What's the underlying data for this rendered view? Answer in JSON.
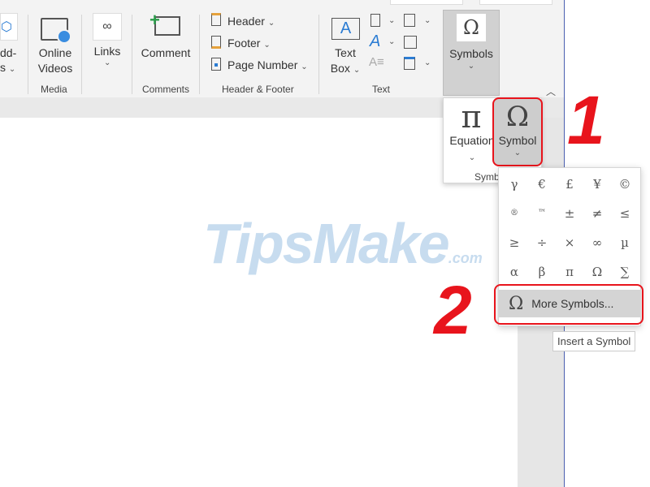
{
  "ribbon": {
    "addins_partial": "dd-",
    "addins_partial2": "s",
    "online_videos": [
      "Online",
      "Videos"
    ],
    "media_group": "Media",
    "links": "Links",
    "comment": "Comment",
    "comments_group": "Comments",
    "header": "Header",
    "footer": "Footer",
    "page_number": "Page Number",
    "header_footer_group": "Header & Footer",
    "text_box": [
      "Text",
      "Box"
    ],
    "text_group": "Text",
    "symbols": "Symbols"
  },
  "symbols_panel": {
    "equation": "Equation",
    "symbol": "Symbol",
    "group_partial": "Symb",
    "equation_glyph": "π",
    "symbol_glyph": "Ω"
  },
  "symbol_gallery": {
    "symbols": [
      "γ",
      "€",
      "£",
      "¥",
      "©",
      "®",
      "™",
      "±",
      "≠",
      "≤",
      "≥",
      "÷",
      "×",
      "∞",
      "µ",
      "α",
      "β",
      "π",
      "Ω",
      "∑"
    ],
    "more_symbols": "More Symbols...",
    "tooltip": "Insert a Symbol"
  },
  "annotations": {
    "step1": "1",
    "step2": "2",
    "highlight_color": "#e8141c"
  },
  "watermark": {
    "main": "TipsMake",
    ".com": ".com"
  }
}
